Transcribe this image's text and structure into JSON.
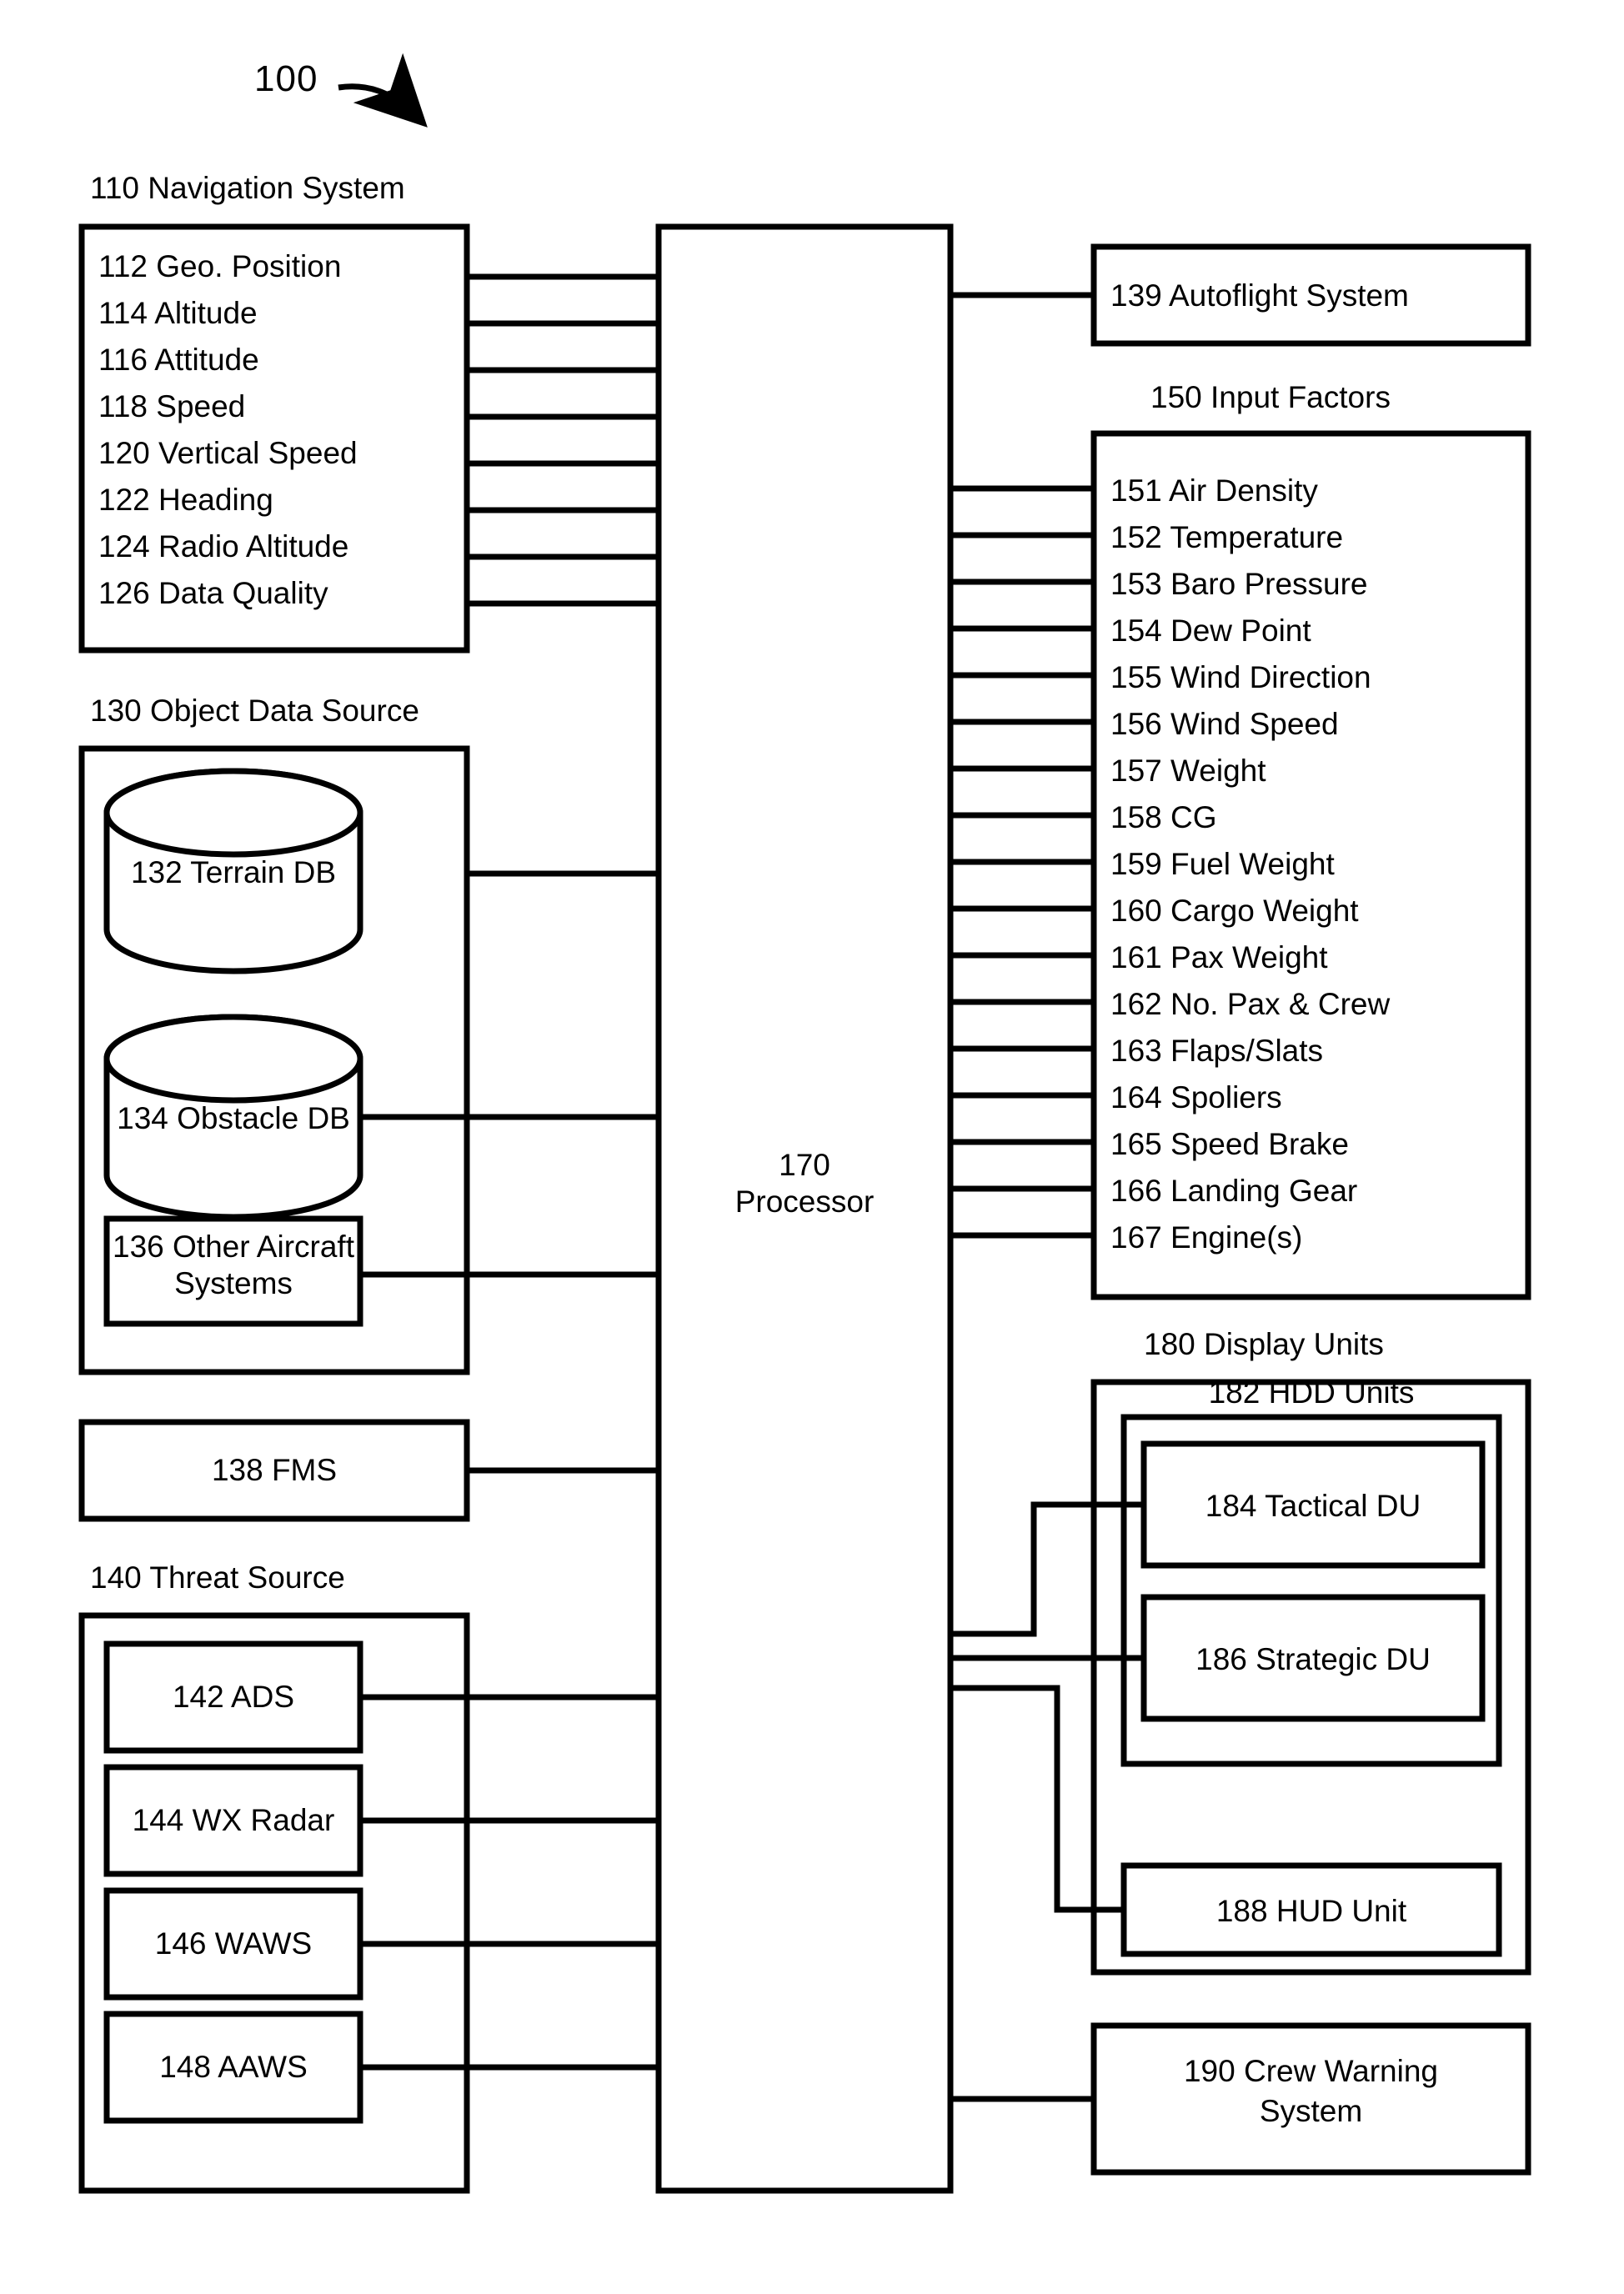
{
  "figure": {
    "reference_numeral": "100"
  },
  "navigation_system": {
    "caption": "110 Navigation System",
    "items": [
      "112 Geo. Position",
      "114 Altitude",
      "116 Attitude",
      "118 Speed",
      "120 Vertical Speed",
      "122 Heading",
      "124 Radio Altitude",
      "126 Data Quality"
    ]
  },
  "object_data_source": {
    "caption": "130 Object Data Source",
    "databases": [
      "132 Terrain DB",
      "134 Obstacle DB"
    ],
    "other_box": "136 Other Aircraft Systems",
    "other_box_line1": "136 Other Aircraft",
    "other_box_line2": "Systems"
  },
  "fms": {
    "label": "138 FMS"
  },
  "threat_source": {
    "caption": "140 Threat Source",
    "items": [
      "142 ADS",
      "144 WX Radar",
      "146 WAWS",
      "148 AAWS"
    ]
  },
  "processor": {
    "numeral": "170",
    "name": "Processor"
  },
  "autoflight_system": {
    "label": "139 Autoflight System"
  },
  "input_factors": {
    "caption": "150 Input Factors",
    "items": [
      "151 Air Density",
      "152 Temperature",
      "153 Baro Pressure",
      "154 Dew Point",
      "155 Wind Direction",
      "156 Wind Speed",
      "157 Weight",
      "158 CG",
      "159 Fuel Weight",
      "160 Cargo Weight",
      "161 Pax Weight",
      "162 No. Pax & Crew",
      "163 Flaps/Slats",
      "164 Spoliers",
      "165 Speed Brake",
      "166 Landing Gear",
      "167 Engine(s)"
    ]
  },
  "display_units": {
    "caption": "180 Display Units",
    "hdd_caption": "182 HDD Units",
    "hdd_items": [
      "184 Tactical DU",
      "186 Strategic DU"
    ],
    "hud": "188 HUD Unit"
  },
  "crew_warning_system": {
    "line1": "190 Crew Warning",
    "line2": "System",
    "label": "190 Crew Warning System"
  },
  "style": {
    "ink": "#000000",
    "paper": "#ffffff"
  }
}
